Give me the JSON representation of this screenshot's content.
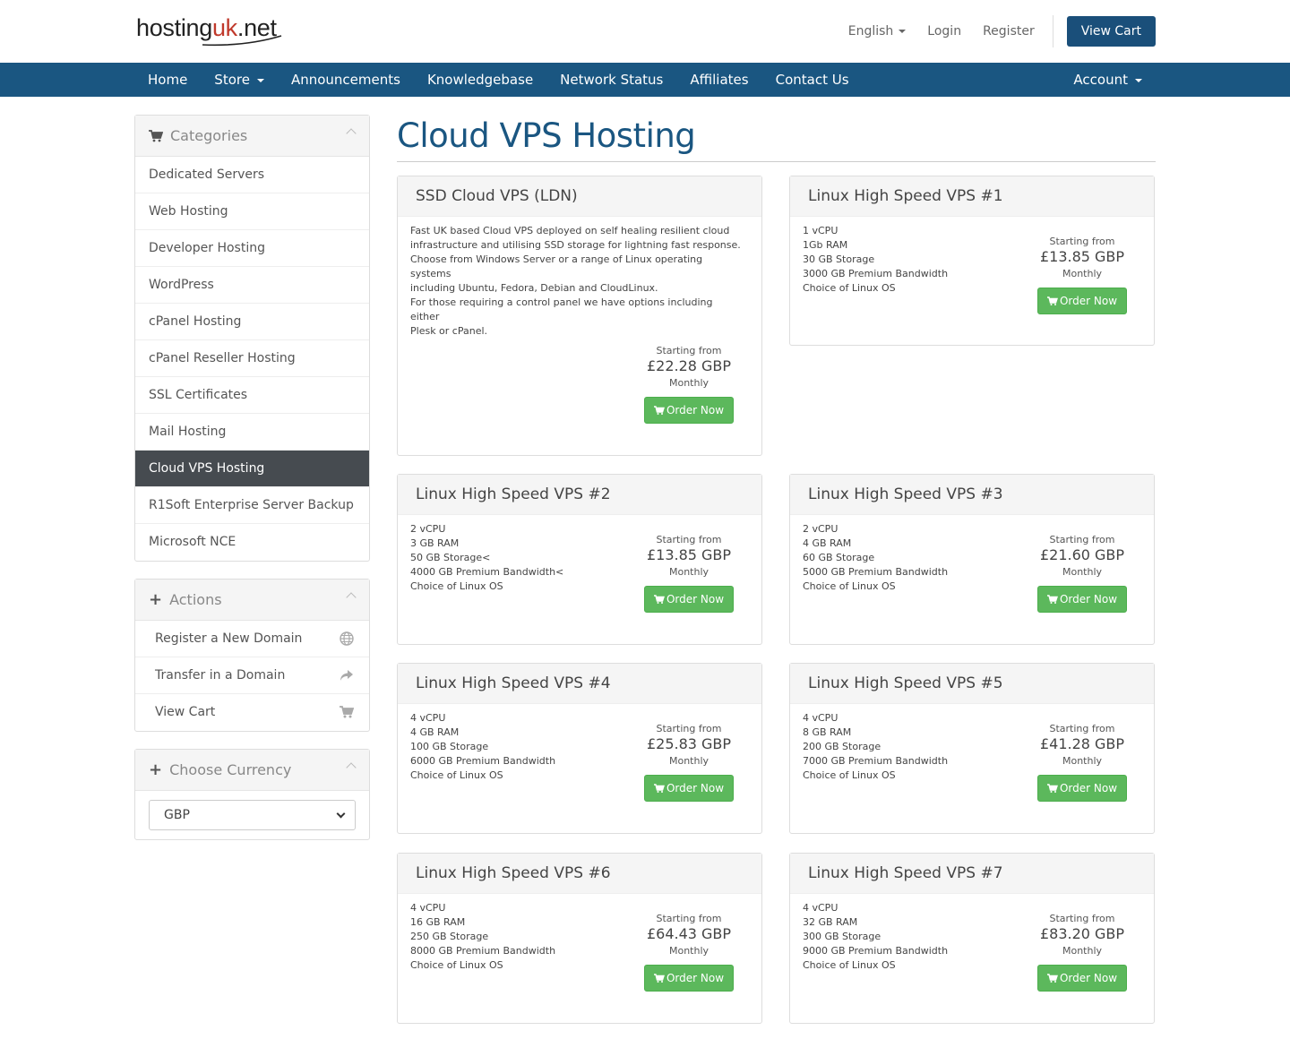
{
  "header": {
    "logo_text_a": "hosting",
    "logo_text_b": "uk",
    "logo_text_c": ".net",
    "language": "English",
    "login": "Login",
    "register": "Register",
    "view_cart": "View Cart"
  },
  "nav": {
    "items": [
      "Home",
      "Store",
      "Announcements",
      "Knowledgebase",
      "Network Status",
      "Affiliates",
      "Contact Us"
    ],
    "account": "Account"
  },
  "sidebar": {
    "categories": {
      "title": "Categories",
      "items": [
        "Dedicated Servers",
        "Web Hosting",
        "Developer Hosting",
        "WordPress",
        "cPanel Hosting",
        "cPanel Reseller Hosting",
        "SSL Certificates",
        "Mail Hosting",
        "Cloud VPS Hosting",
        "R1Soft Enterprise Server Backup",
        "Microsoft NCE"
      ],
      "active_index": 8
    },
    "actions": {
      "title": "Actions",
      "items": [
        "Register a New Domain",
        "Transfer in a Domain",
        "View Cart"
      ]
    },
    "currency": {
      "title": "Choose Currency",
      "selected": "GBP"
    }
  },
  "main": {
    "title": "Cloud VPS Hosting",
    "starting_from": "Starting from",
    "cycle": "Monthly",
    "order_label": "Order Now",
    "products": [
      {
        "name": "SSD Cloud VPS (LDN)",
        "features": [
          "Fast UK based Cloud VPS deployed on self healing resilient cloud",
          "infrastructure and utilising SSD storage for lightning fast response.",
          "Choose from Windows Server or a range of Linux operating systems",
          "including Ubuntu, Fedora, Debian and CloudLinux.",
          "For those requiring a control panel we have options including either",
          "Plesk or cPanel."
        ],
        "price": "£22.28 GBP"
      },
      {
        "name": "Linux High Speed VPS #1",
        "features": [
          "1 vCPU",
          "1Gb RAM",
          "30 GB Storage",
          "3000 GB Premium Bandwidth",
          "Choice of Linux OS"
        ],
        "price": "£13.85 GBP"
      },
      {
        "name": "Linux High Speed VPS #2",
        "features": [
          "2 vCPU",
          "3 GB RAM",
          "50 GB Storage<",
          "4000 GB Premium Bandwidth<",
          "Choice of Linux OS"
        ],
        "price": "£13.85 GBP"
      },
      {
        "name": "Linux High Speed VPS #3",
        "features": [
          "2 vCPU",
          "4 GB RAM",
          "60 GB Storage",
          "5000 GB Premium Bandwidth",
          "Choice of Linux OS"
        ],
        "price": "£21.60 GBP"
      },
      {
        "name": "Linux High Speed VPS #4",
        "features": [
          "4 vCPU",
          "4 GB RAM",
          "100 GB Storage",
          "6000 GB Premium Bandwidth",
          "Choice of Linux OS"
        ],
        "price": "£25.83 GBP"
      },
      {
        "name": "Linux High Speed VPS #5",
        "features": [
          "4 vCPU",
          "8 GB RAM",
          "200 GB Storage",
          "7000 GB Premium Bandwidth",
          "Choice of Linux OS"
        ],
        "price": "£41.28 GBP"
      },
      {
        "name": "Linux High Speed VPS #6",
        "features": [
          "4 vCPU",
          "16 GB RAM",
          "250 GB Storage",
          "8000 GB Premium Bandwidth",
          "Choice of Linux OS"
        ],
        "price": "£64.43 GBP"
      },
      {
        "name": "Linux High Speed VPS #7",
        "features": [
          "4 vCPU",
          "32 GB RAM",
          "300 GB Storage",
          "9000 GB Premium Bandwidth",
          "Choice of Linux OS"
        ],
        "price": "£83.20 GBP"
      }
    ]
  },
  "colors": {
    "brand_blue": "#1a5681",
    "order_green": "#5cb85c",
    "active_item": "#464b50"
  }
}
